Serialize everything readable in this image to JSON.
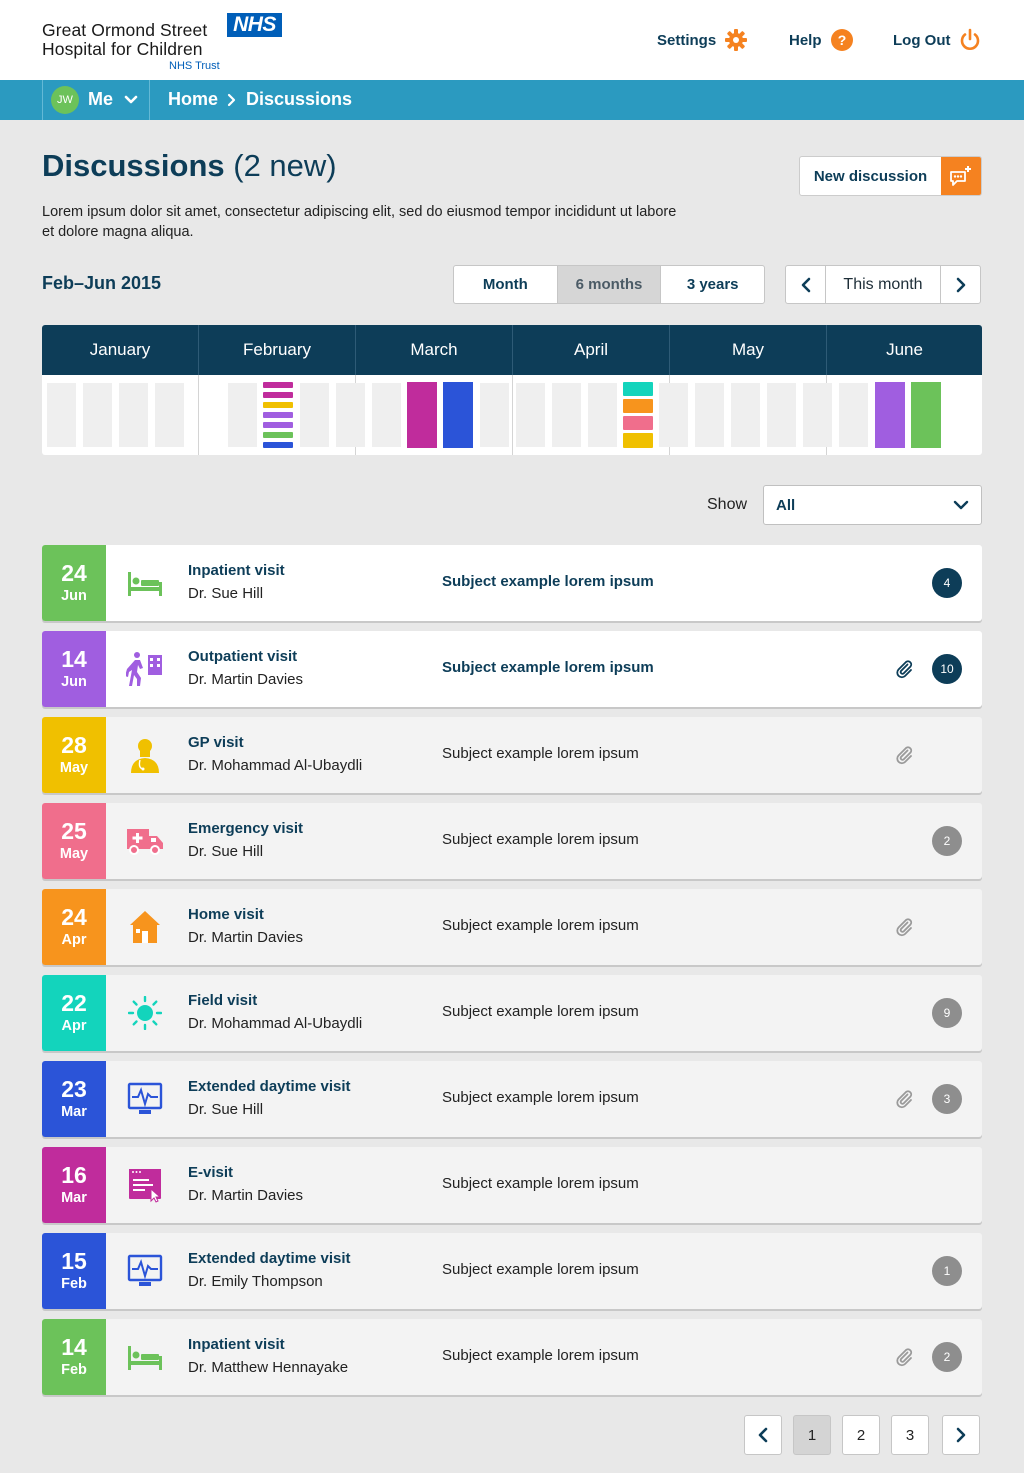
{
  "header": {
    "logo_line1": "Great Ormond Street",
    "logo_line2": "Hospital for Children",
    "logo_nhs": "NHS",
    "logo_trust": "NHS Trust",
    "settings": "Settings",
    "help": "Help",
    "logout": "Log Out",
    "accent": "#f58220"
  },
  "nav": {
    "initials": "JW",
    "me": "Me",
    "crumb_home": "Home",
    "crumb_current": "Discussions"
  },
  "page": {
    "title": "Discussions",
    "new_count": "(2 new)",
    "intro": "Lorem ipsum dolor sit amet, consectetur adipiscing elit, sed do eiusmod tempor incididunt ut labore et dolore magna aliqua.",
    "new_button": "New discussion"
  },
  "range": {
    "label": "Feb–Jun 2015",
    "options": [
      "Month",
      "6 months",
      "3 years"
    ],
    "selected": "6 months",
    "current": "This month"
  },
  "timeline": {
    "months": [
      "January",
      "February",
      "March",
      "April",
      "May",
      "June"
    ]
  },
  "filter": {
    "label": "Show",
    "value": "All"
  },
  "colors": {
    "inpatient": "#6cc25a",
    "outpatient": "#a05ee0",
    "gp": "#f0c000",
    "emergency": "#f06e8c",
    "home": "#f7941d",
    "field": "#13d4bc",
    "extended": "#2b54d8",
    "evisit": "#c02c9c",
    "navy": "#0d3d58",
    "teal": "#2b9ac0"
  },
  "discussions": [
    {
      "day": "24",
      "month": "Jun",
      "type": "Inpatient visit",
      "doctor": "Dr. Sue Hill",
      "subject": "Subject example lorem ipsum",
      "unread": true,
      "attachment": false,
      "count": "4",
      "icon": "bed-icon",
      "color": "#6cc25a"
    },
    {
      "day": "14",
      "month": "Jun",
      "type": "Outpatient visit",
      "doctor": "Dr. Martin Davies",
      "subject": "Subject example lorem ipsum",
      "unread": true,
      "attachment": true,
      "count": "10",
      "icon": "walking-hospital-icon",
      "color": "#a05ee0"
    },
    {
      "day": "28",
      "month": "May",
      "type": "GP visit",
      "doctor": "Dr. Mohammad Al-Ubaydli",
      "subject": "Subject example lorem ipsum",
      "unread": false,
      "attachment": true,
      "count": "",
      "icon": "doctor-icon",
      "color": "#f0c000"
    },
    {
      "day": "25",
      "month": "May",
      "type": "Emergency visit",
      "doctor": "Dr. Sue Hill",
      "subject": "Subject example lorem ipsum",
      "unread": false,
      "attachment": false,
      "count": "2",
      "icon": "ambulance-icon",
      "color": "#f06e8c"
    },
    {
      "day": "24",
      "month": "Apr",
      "type": "Home visit",
      "doctor": "Dr. Martin Davies",
      "subject": "Subject example lorem ipsum",
      "unread": false,
      "attachment": true,
      "count": "",
      "icon": "house-icon",
      "color": "#f7941d"
    },
    {
      "day": "22",
      "month": "Apr",
      "type": "Field visit",
      "doctor": "Dr. Mohammad Al-Ubaydli",
      "subject": "Subject example lorem ipsum",
      "unread": false,
      "attachment": false,
      "count": "9",
      "icon": "sun-icon",
      "color": "#13d4bc"
    },
    {
      "day": "23",
      "month": "Mar",
      "type": "Extended daytime visit",
      "doctor": "Dr. Sue Hill",
      "subject": "Subject example lorem ipsum",
      "unread": false,
      "attachment": true,
      "count": "3",
      "icon": "heart-monitor-icon",
      "color": "#2b54d8"
    },
    {
      "day": "16",
      "month": "Mar",
      "type": "E-visit",
      "doctor": "Dr. Martin Davies",
      "subject": "Subject example lorem ipsum",
      "unread": false,
      "attachment": false,
      "count": "",
      "icon": "browser-window-icon",
      "color": "#c02c9c"
    },
    {
      "day": "15",
      "month": "Feb",
      "type": "Extended daytime visit",
      "doctor": "Dr. Emily Thompson",
      "subject": "Subject example lorem ipsum",
      "unread": false,
      "attachment": false,
      "count": "1",
      "icon": "heart-monitor-icon",
      "color": "#2b54d8"
    },
    {
      "day": "14",
      "month": "Feb",
      "type": "Inpatient visit",
      "doctor": "Dr. Matthew Hennayake",
      "subject": "Subject example lorem ipsum",
      "unread": false,
      "attachment": true,
      "count": "2",
      "icon": "bed-icon",
      "color": "#6cc25a"
    }
  ],
  "pagination": {
    "pages": [
      "1",
      "2",
      "3"
    ],
    "current": "1"
  }
}
